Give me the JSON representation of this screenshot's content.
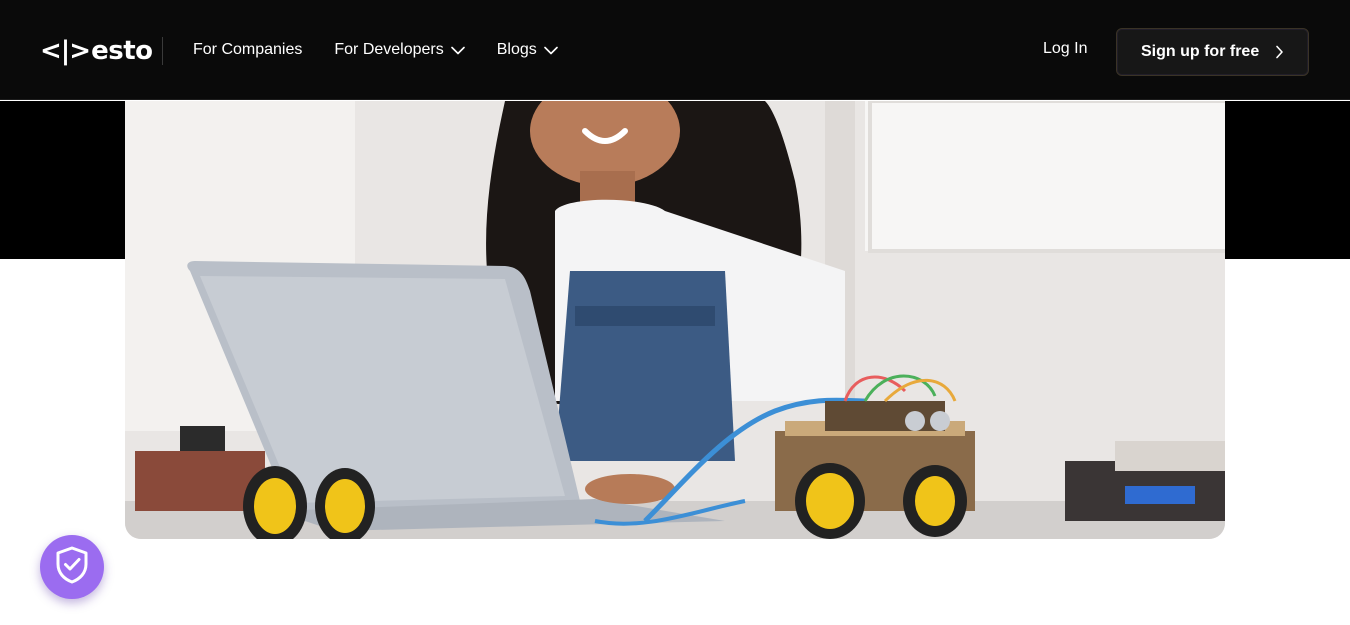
{
  "brand": {
    "logo_mark": "<|>",
    "logo_text": "esto"
  },
  "nav": {
    "items": [
      {
        "label": "For Companies",
        "has_dropdown": false
      },
      {
        "label": "For Developers",
        "has_dropdown": true
      },
      {
        "label": "Blogs",
        "has_dropdown": true
      }
    ],
    "login_label": "Log In",
    "signup_label": "Sign up for free"
  },
  "icons": {
    "dropdown": "chevron-down-icon",
    "signup_arrow": "chevron-right-icon",
    "fab": "shield-check-icon"
  },
  "colors": {
    "nav_bg": "#0a0a0a",
    "hero_band": "#000000",
    "fab_bg": "#9b6cf0",
    "text_on_dark": "#ffffff"
  }
}
